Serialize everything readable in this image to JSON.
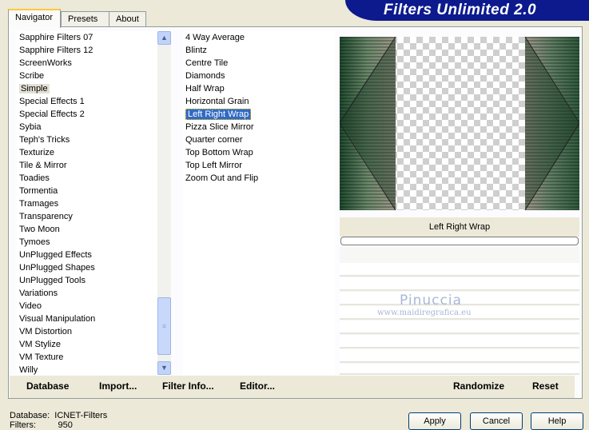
{
  "tabs": [
    "Navigator",
    "Presets",
    "About"
  ],
  "app_title": "Filters Unlimited 2.0",
  "categories": [
    "Sapphire Filters 07",
    "Sapphire Filters 12",
    "ScreenWorks",
    "Scribe",
    "Simple",
    "Special Effects 1",
    "Special Effects 2",
    "Sybia",
    "Teph's Tricks",
    "Texturize",
    "Tile & Mirror",
    "Toadies",
    "Tormentia",
    "Tramages",
    "Transparency",
    "Two Moon",
    "Tymoes",
    "UnPlugged Effects",
    "UnPlugged Shapes",
    "UnPlugged Tools",
    "Variations",
    "Video",
    "Visual Manipulation",
    "VM Distortion",
    "VM Stylize",
    "VM Texture",
    "Willy"
  ],
  "selected_category": "Simple",
  "filters": [
    "4 Way Average",
    "Blintz",
    "Centre Tile",
    "Diamonds",
    "Half Wrap",
    "Horizontal Grain",
    "Left Right Wrap",
    "Pizza Slice Mirror",
    "Quarter corner",
    "Top Bottom Wrap",
    "Top Left Mirror",
    "Zoom Out and Flip"
  ],
  "selected_filter": "Left Right Wrap",
  "preview_label": "Left Right Wrap",
  "buttons": {
    "database": "Database",
    "import": "Import...",
    "filter_info": "Filter Info...",
    "editor": "Editor...",
    "randomize": "Randomize",
    "reset": "Reset",
    "apply": "Apply",
    "cancel": "Cancel",
    "help": "Help"
  },
  "status": {
    "database_label": "Database:",
    "database_value": "ICNET-Filters",
    "filters_label": "Filters:",
    "filters_value": "950"
  },
  "watermark": {
    "name": "Pinuccia",
    "url": "www.maidiregrafica.eu"
  },
  "colors": {
    "title_bar": "#0c1a8e",
    "selection": "#316ac5",
    "preview_green": "#2f5a3c"
  },
  "icons": {
    "scroll_up": "chevron-up-icon",
    "scroll_down": "chevron-down-icon",
    "scroll_grip": "grip-icon"
  }
}
